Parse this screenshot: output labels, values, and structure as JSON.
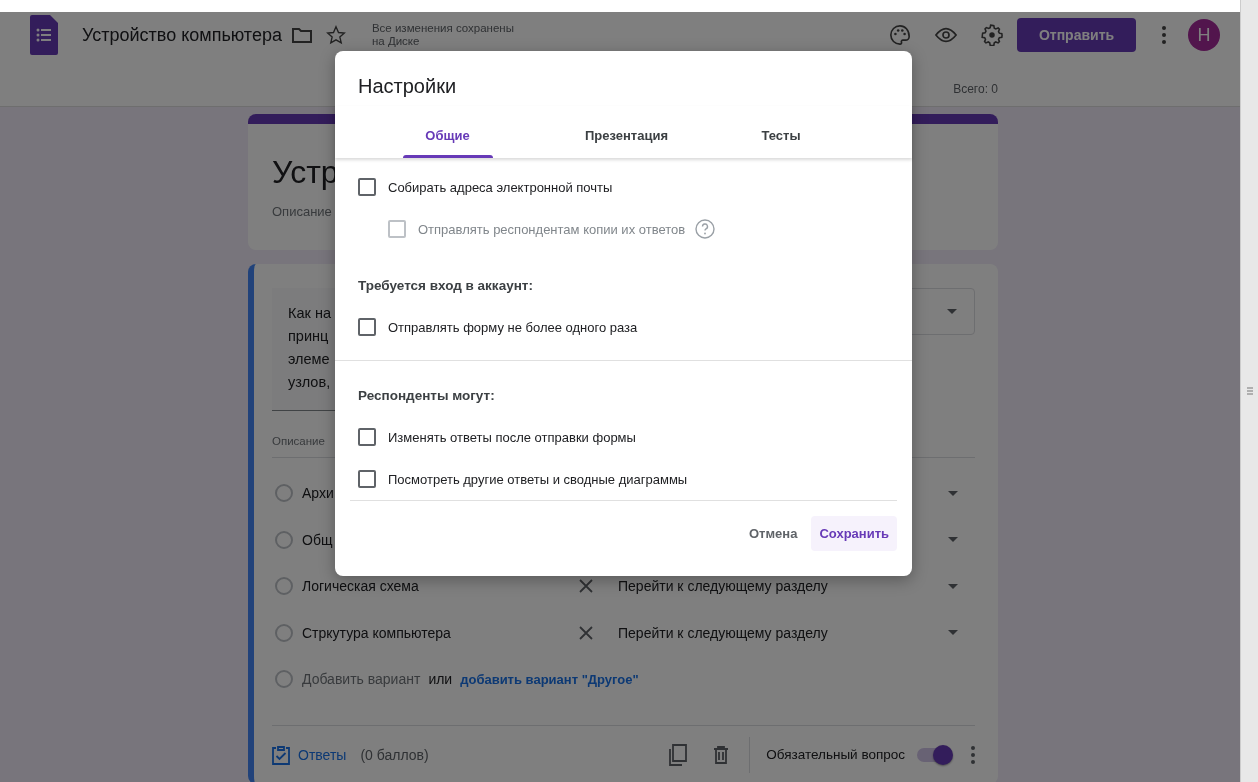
{
  "header": {
    "title": "Устройство компьютера",
    "save_status": [
      "Все изменения сохранены",
      "на Диске"
    ],
    "send_button": "Отправить",
    "avatar": "Н",
    "total": "Всего: 0"
  },
  "form": {
    "title": "Устр",
    "description": "Описание",
    "question": {
      "text_lines": [
        "Как на",
        "принц",
        "элеме",
        "узлов,"
      ],
      "description": "Описание",
      "options": [
        {
          "label": "Архи",
          "selected": false
        },
        {
          "label": "Общ",
          "selected": false
        },
        {
          "label": "Логическая схема",
          "selected": false,
          "go_to": "Перейти к следующему разделу"
        },
        {
          "label": "Стркутура компьютера",
          "selected": false,
          "go_to": "Перейти к следующему разделу"
        }
      ],
      "add_row": {
        "selected": false,
        "label": "Добавить вариант",
        "or": "или",
        "other_link": "добавить вариант \"Другое\""
      },
      "answers": "Ответы",
      "points": "(0 баллов)",
      "required_label": "Обязательный вопрос",
      "required": true
    }
  },
  "dialog": {
    "title": "Настройки",
    "tabs": [
      {
        "label": "Общие",
        "selected": true
      },
      {
        "label": "Презентация",
        "selected": false
      },
      {
        "label": "Тесты",
        "selected": false
      }
    ],
    "groups": [
      {
        "separator": false,
        "items": [
          {
            "label": "Собирать адреса электронной почты",
            "checked": false,
            "disabled": false,
            "children": [
              {
                "label": "Отправлять респондентам копии их ответов",
                "checked": false,
                "disabled": true,
                "help_icon": true
              }
            ]
          }
        ]
      },
      {
        "separator": false,
        "heading": "Требуется вход в аккаунт:",
        "items": [
          {
            "label": "Отправлять форму не более одного раза",
            "checked": false,
            "disabled": false
          }
        ]
      },
      {
        "separator": true,
        "heading": "Респонденты могут:",
        "items": [
          {
            "label": "Изменять ответы после отправки формы",
            "checked": false,
            "disabled": false
          },
          {
            "label": "Посмотреть другие ответы и сводные диаграммы",
            "checked": false,
            "disabled": false
          }
        ]
      }
    ],
    "cancel": "Отмена",
    "save": "Сохранить"
  }
}
